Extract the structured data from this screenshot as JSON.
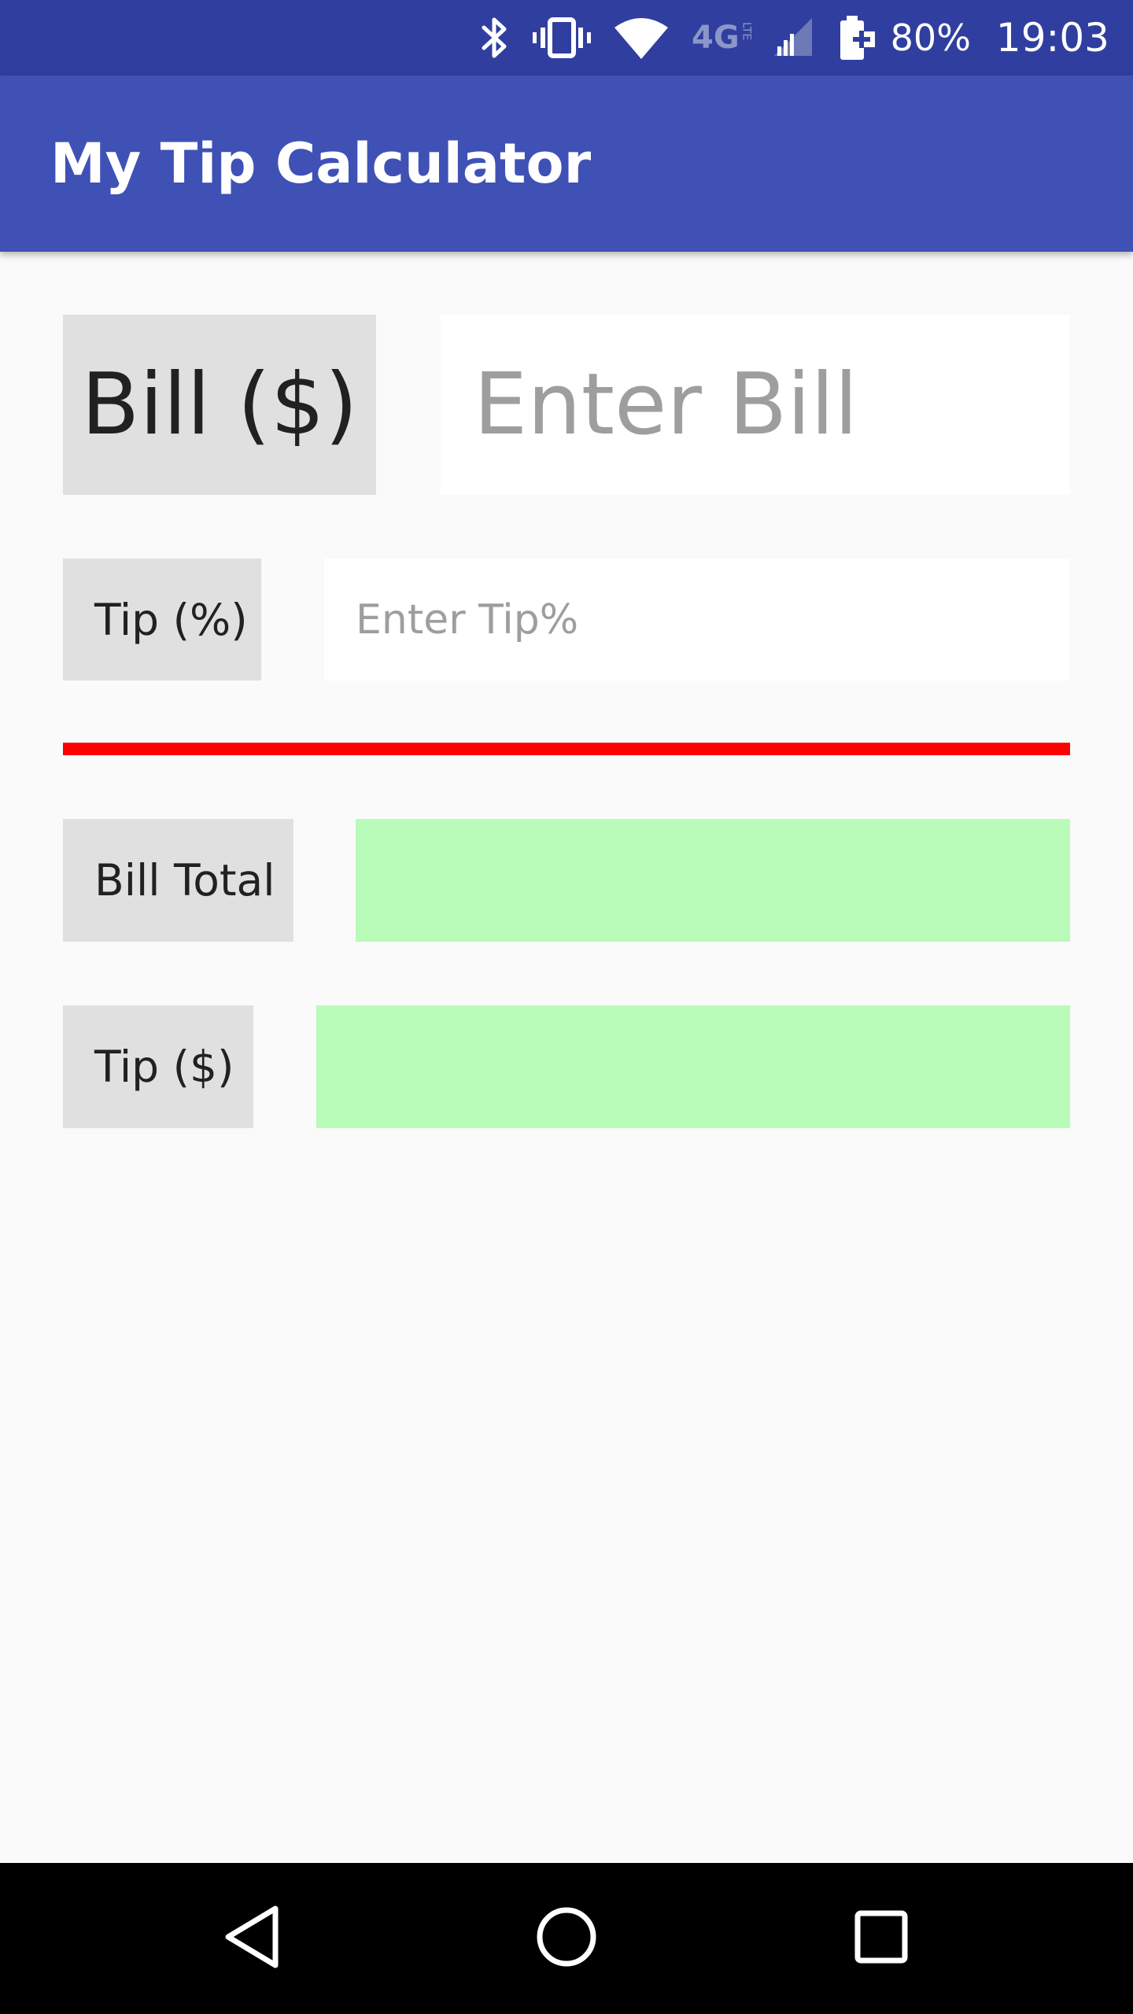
{
  "status_bar": {
    "battery_percent": "80%",
    "time": "19:03",
    "network_type": "4G",
    "network_sub": "LTE",
    "icons": [
      "bluetooth-icon",
      "vibrate-icon",
      "wifi-icon",
      "network-4g-lte-icon",
      "cell-signal-icon",
      "battery-charging-icon"
    ]
  },
  "app_bar": {
    "title": "My Tip Calculator"
  },
  "form": {
    "bill_label": "Bill ($)",
    "bill_placeholder": "Enter Bill",
    "bill_value": "",
    "tip_percent_label": "Tip (%)",
    "tip_percent_placeholder": "Enter Tip%",
    "tip_percent_value": ""
  },
  "results": {
    "bill_total_label": "Bill Total",
    "bill_total_value": "",
    "tip_amount_label": "Tip ($)",
    "tip_amount_value": ""
  },
  "colors": {
    "status_bar": "#303f9f",
    "app_bar": "#3f51b5",
    "background": "#fafafa",
    "label_background": "#e0e0e0",
    "result_background": "#b9fbb9",
    "divider": "#ff0000",
    "nav_bar": "#000000"
  },
  "nav_bar": {
    "icons": [
      "back-icon",
      "home-icon",
      "recents-icon"
    ]
  }
}
